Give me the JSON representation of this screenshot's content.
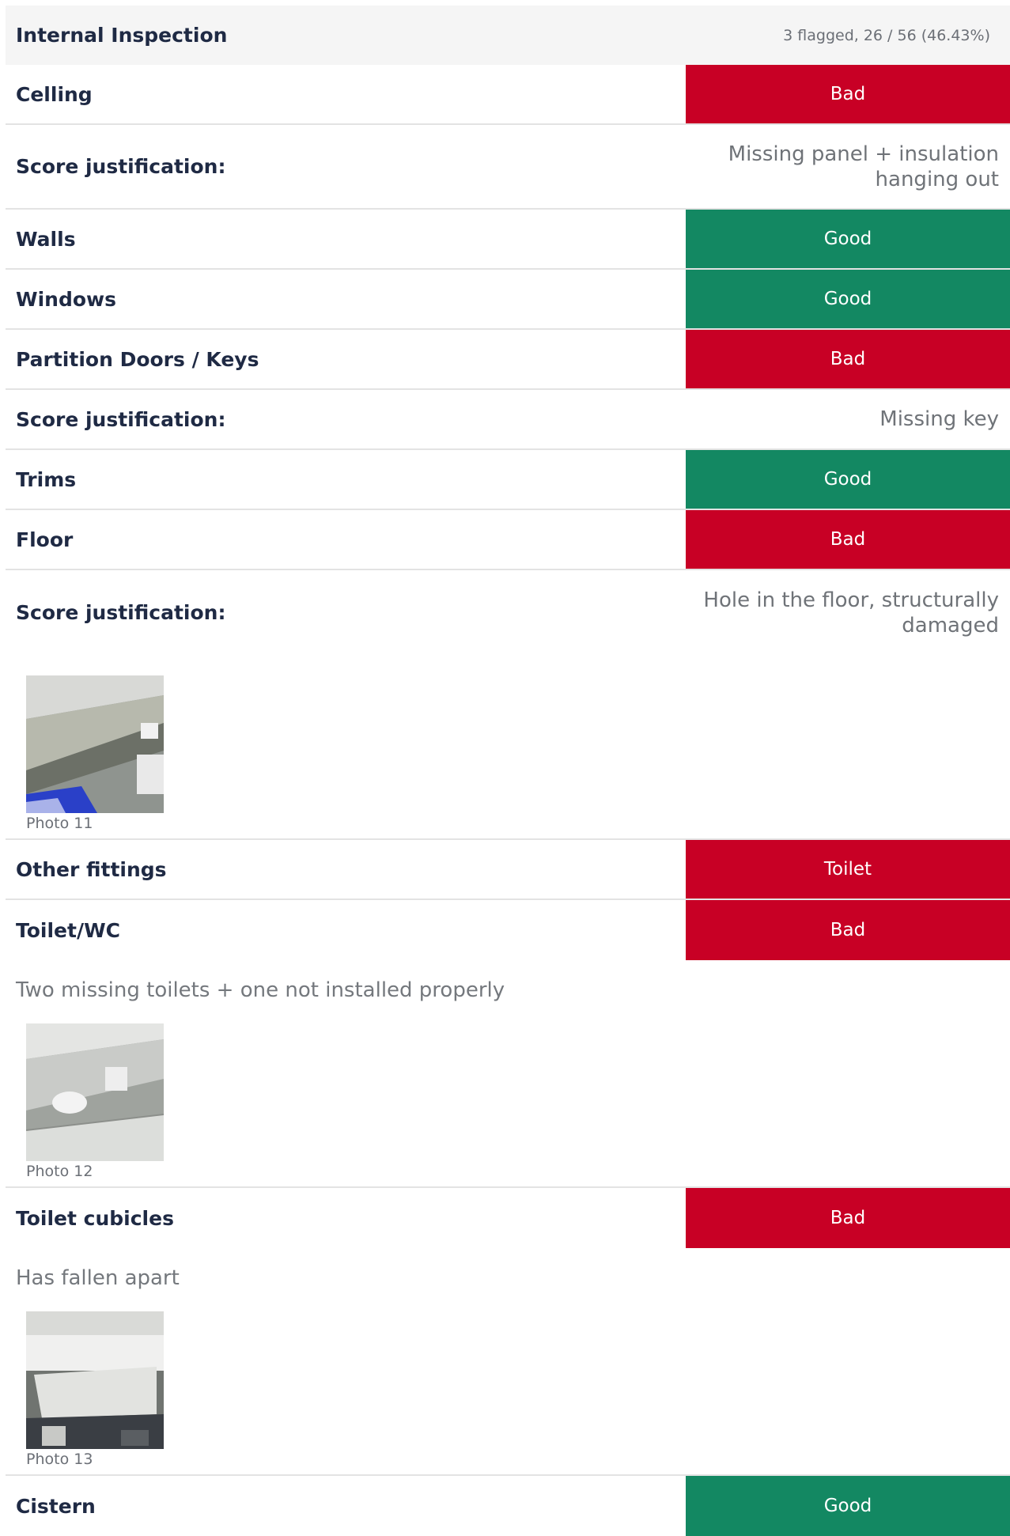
{
  "section": {
    "title": "Internal Inspection",
    "stats": "3 flagged, 26 / 56 (46.43%)"
  },
  "rows": {
    "ceiling": {
      "label": "Celling",
      "value": "Bad"
    },
    "ceiling_just": {
      "label": "Score justification:",
      "value": "Missing panel + insulation hanging out"
    },
    "walls": {
      "label": "Walls",
      "value": "Good"
    },
    "windows": {
      "label": "Windows",
      "value": "Good"
    },
    "doors": {
      "label": "Partition Doors / Keys",
      "value": "Bad"
    },
    "doors_just": {
      "label": "Score justification:",
      "value": "Missing key"
    },
    "trims": {
      "label": "Trims",
      "value": "Good"
    },
    "floor": {
      "label": "Floor",
      "value": "Bad"
    },
    "floor_just": {
      "label": "Score justification:",
      "value": "Hole in the floor, structurally damaged"
    },
    "floor_photo": {
      "caption": "Photo 11"
    },
    "other_fittings": {
      "label": "Other fittings",
      "value": "Toilet"
    },
    "toilet_wc": {
      "label": "Toilet/WC",
      "value": "Bad",
      "note": "Two missing toilets + one not installed properly"
    },
    "toilet_photo": {
      "caption": "Photo 12"
    },
    "cubicles": {
      "label": "Toilet cubicles",
      "value": "Bad",
      "note": "Has fallen apart"
    },
    "cubicles_photo": {
      "caption": "Photo 13"
    },
    "cistern": {
      "label": "Cistern",
      "value": "Good"
    }
  },
  "colors": {
    "bad": "#c80025",
    "good": "#138862",
    "label": "#1f2a44",
    "muted": "#6f7378"
  }
}
